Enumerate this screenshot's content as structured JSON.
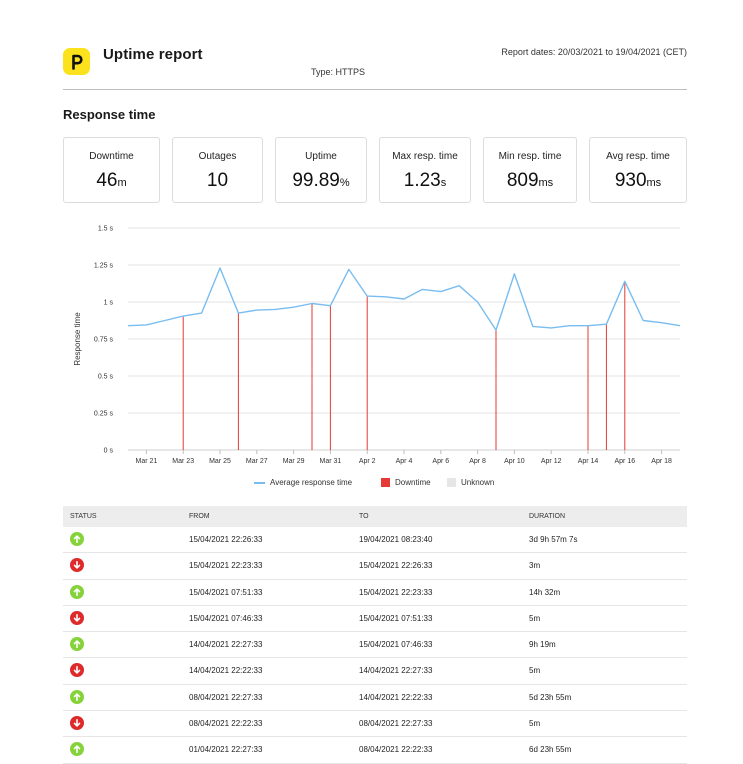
{
  "header": {
    "title": "Uptime report",
    "type_label": "Type: HTTPS",
    "report_dates": "Report dates: 20/03/2021 to 19/04/2021 (CET)",
    "logo_icon": "p-logo-icon",
    "logo_color": "#fbe21d"
  },
  "section_title": "Response time",
  "cards": [
    {
      "label": "Downtime",
      "value": "46",
      "unit": "m"
    },
    {
      "label": "Outages",
      "value": "10",
      "unit": ""
    },
    {
      "label": "Uptime",
      "value": "99.89",
      "unit": "%"
    },
    {
      "label": "Max resp. time",
      "value": "1.23",
      "unit": "s"
    },
    {
      "label": "Min resp. time",
      "value": "809",
      "unit": "ms"
    },
    {
      "label": "Avg resp. time",
      "value": "930",
      "unit": "ms"
    }
  ],
  "chart_data": {
    "type": "line",
    "title": "",
    "xlabel": "",
    "ylabel": "Response time",
    "ylim": [
      0,
      1.5
    ],
    "y_ticks": [
      "0 s",
      "0.25 s",
      "0.5 s",
      "0.75 s",
      "1 s",
      "1.25 s",
      "1.5 s"
    ],
    "y_tick_values": [
      0,
      0.25,
      0.5,
      0.75,
      1,
      1.25,
      1.5
    ],
    "xlim": [
      "2021-03-20",
      "2021-04-19"
    ],
    "x_tick_labels": [
      "Mar 21",
      "Mar 23",
      "Mar 25",
      "Mar 27",
      "Mar 29",
      "Mar 31",
      "Apr 2",
      "Apr 4",
      "Apr 6",
      "Apr 8",
      "Apr 10",
      "Apr 12",
      "Apr 14",
      "Apr 16",
      "Apr 18"
    ],
    "x_tick_dates": [
      "2021-03-21",
      "2021-03-23",
      "2021-03-25",
      "2021-03-27",
      "2021-03-29",
      "2021-03-31",
      "2021-04-02",
      "2021-04-04",
      "2021-04-06",
      "2021-04-08",
      "2021-04-10",
      "2021-04-12",
      "2021-04-14",
      "2021-04-16",
      "2021-04-18"
    ],
    "grid": true,
    "legend_position": "bottom",
    "series": [
      {
        "name": "Average response time",
        "color": "#79bdf0",
        "x": [
          "2021-03-20",
          "2021-03-21",
          "2021-03-22",
          "2021-03-23",
          "2021-03-24",
          "2021-03-25",
          "2021-03-26",
          "2021-03-27",
          "2021-03-28",
          "2021-03-29",
          "2021-03-30",
          "2021-03-31",
          "2021-04-01",
          "2021-04-02",
          "2021-04-03",
          "2021-04-04",
          "2021-04-05",
          "2021-04-06",
          "2021-04-07",
          "2021-04-08",
          "2021-04-09",
          "2021-04-10",
          "2021-04-11",
          "2021-04-12",
          "2021-04-13",
          "2021-04-14",
          "2021-04-15",
          "2021-04-16",
          "2021-04-17",
          "2021-04-18",
          "2021-04-19"
        ],
        "y": [
          0.84,
          0.845,
          0.875,
          0.905,
          0.925,
          1.23,
          0.925,
          0.945,
          0.95,
          0.965,
          0.99,
          0.975,
          1.22,
          1.04,
          1.035,
          1.02,
          1.085,
          1.07,
          1.11,
          1.0,
          0.81,
          1.19,
          0.835,
          0.825,
          0.84,
          0.84,
          0.85,
          1.14,
          0.875,
          0.86,
          0.84
        ]
      },
      {
        "name": "Downtime",
        "color": "#e53935",
        "x": [
          "2021-03-23",
          "2021-03-26",
          "2021-03-30",
          "2021-03-31",
          "2021-04-02",
          "2021-04-09",
          "2021-04-14",
          "2021-04-15",
          "2021-04-16"
        ],
        "y": [
          0.9,
          0.925,
          0.99,
          0.975,
          1.04,
          0.81,
          0.84,
          0.85,
          1.13
        ]
      },
      {
        "name": "Unknown",
        "color": "#e6e6e6",
        "x": [],
        "y": []
      }
    ]
  },
  "table": {
    "headers": [
      "STATUS",
      "FROM",
      "TO",
      "DURATION"
    ],
    "rows": [
      {
        "status": "up",
        "from": "15/04/2021 22:26:33",
        "to": "19/04/2021 08:23:40",
        "duration": "3d 9h 57m 7s"
      },
      {
        "status": "down",
        "from": "15/04/2021 22:23:33",
        "to": "15/04/2021 22:26:33",
        "duration": "3m"
      },
      {
        "status": "up",
        "from": "15/04/2021 07:51:33",
        "to": "15/04/2021 22:23:33",
        "duration": "14h 32m"
      },
      {
        "status": "down",
        "from": "15/04/2021 07:46:33",
        "to": "15/04/2021 07:51:33",
        "duration": "5m"
      },
      {
        "status": "up",
        "from": "14/04/2021 22:27:33",
        "to": "15/04/2021 07:46:33",
        "duration": "9h 19m"
      },
      {
        "status": "down",
        "from": "14/04/2021 22:22:33",
        "to": "14/04/2021 22:27:33",
        "duration": "5m"
      },
      {
        "status": "up",
        "from": "08/04/2021 22:27:33",
        "to": "14/04/2021 22:22:33",
        "duration": "5d 23h 55m"
      },
      {
        "status": "down",
        "from": "08/04/2021 22:22:33",
        "to": "08/04/2021 22:27:33",
        "duration": "5m"
      },
      {
        "status": "up",
        "from": "01/04/2021 22:27:33",
        "to": "08/04/2021 22:22:33",
        "duration": "6d 23h 55m"
      }
    ],
    "status_colors": {
      "up": "#86d23a",
      "down": "#dd2a2a"
    },
    "status_icons": {
      "up": "arrow-up-icon",
      "down": "arrow-down-icon"
    }
  }
}
